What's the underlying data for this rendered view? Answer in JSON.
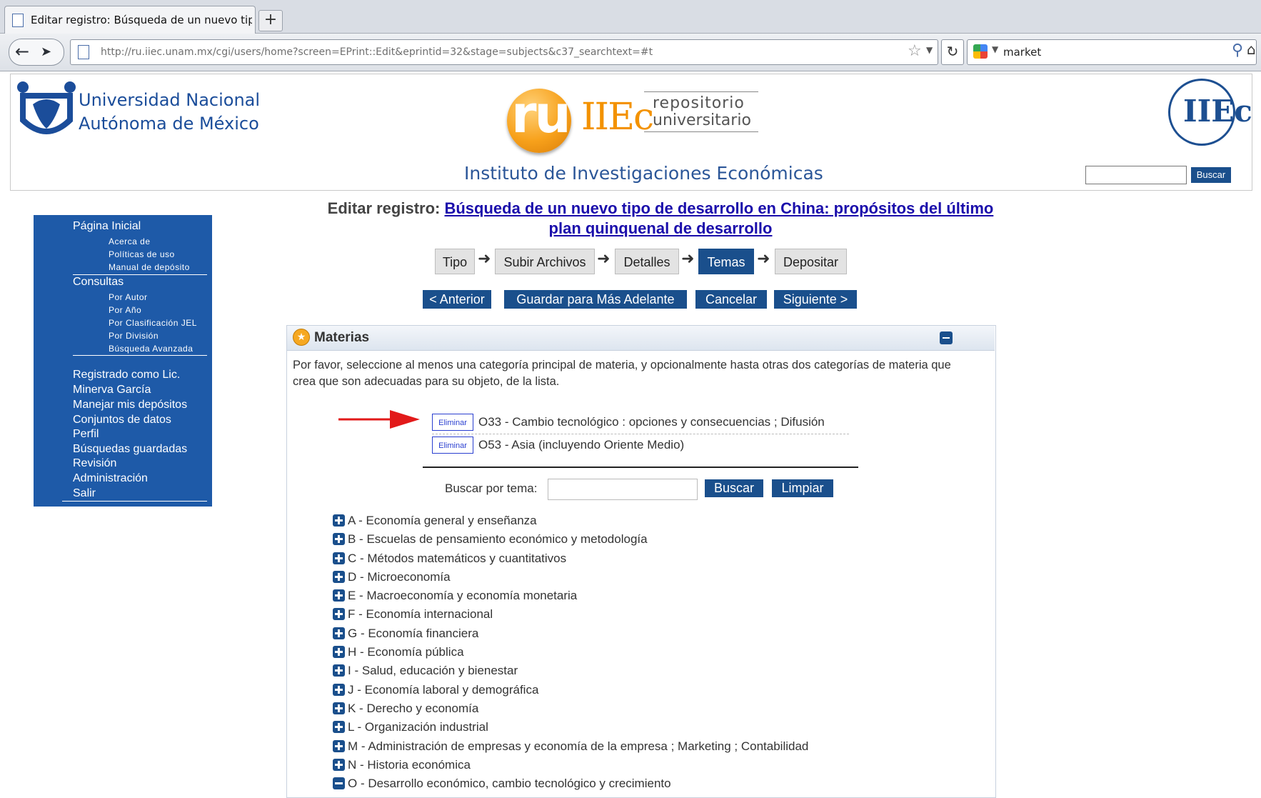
{
  "browser": {
    "tab_title": "Editar registro: Búsqueda de un nuevo tipo ...",
    "new_tab": "+",
    "url": "http://ru.iiec.unam.mx/cgi/users/home?screen=EPrint::Edit&eprintid=32&stage=subjects&c37_searchtext=#t",
    "search_query": "market"
  },
  "header": {
    "unam_line1": "Universidad Nacional",
    "unam_line2": "Autónoma de México",
    "ru": "ru",
    "iiec": "IIEc",
    "repo_line1": "repositorio",
    "repo_line2": "universitario",
    "instituto": "Instituto de Investigaciones Económicas",
    "search_button": "Buscar"
  },
  "sidebar": {
    "pagina_inicial": "Página Inicial",
    "acerca": "Acerca de",
    "politicas": "Políticas de uso",
    "manual": "Manual de depósito",
    "consultas": "Consultas",
    "por_autor": "Por Autor",
    "por_anio": "Por Año",
    "por_jel": "Por Clasificación JEL",
    "por_division": "Por División",
    "busqueda_avanzada": "Búsqueda Avanzada",
    "registrado": "Registrado como Lic.",
    "usuario": "Minerva García",
    "manejar": "Manejar mis depósitos",
    "conjuntos": "Conjuntos de datos",
    "perfil": "Perfil",
    "busquedas": "Búsquedas guardadas",
    "revision": "Revisión",
    "administracion": "Administración",
    "salir": "Salir"
  },
  "main": {
    "edit_prefix": "Editar registro:",
    "record_title_line1": "Búsqueda de un nuevo tipo de desarrollo en China: propósitos del último",
    "record_title_line2": "plan quinquenal de desarrollo",
    "steps": [
      "Tipo",
      "Subir Archivos",
      "Detalles",
      "Temas",
      "Depositar"
    ],
    "active_step": "Temas",
    "buttons": {
      "anterior": "< Anterior",
      "guardar": "Guardar para Más Adelante",
      "cancelar": "Cancelar",
      "siguiente": "Siguiente >"
    }
  },
  "panel": {
    "title": "Materias",
    "instructions": "Por favor, seleccione al menos una categoría principal de materia, y opcionalmente hasta otras dos categorías de materia que crea que son adecuadas para su objeto, de la lista.",
    "eliminar_label": "Eliminar",
    "selected": [
      "O33 - Cambio tecnológico : opciones y consecuencias ; Difusión",
      "O53 - Asia (incluyendo Oriente Medio)"
    ],
    "search_label": "Buscar por tema:",
    "search_value": "",
    "buscar": "Buscar",
    "limpiar": "Limpiar",
    "tree": [
      "A - Economía general y enseñanza",
      "B - Escuelas de pensamiento económico y metodología",
      "C - Métodos matemáticos y cuantitativos",
      "D - Microeconomía",
      "E - Macroeconomía y economía monetaria",
      "F - Economía internacional",
      "G - Economía financiera",
      "H - Economía pública",
      "I - Salud, educación y bienestar",
      "J - Economía laboral y demográfica",
      "K - Derecho y economía",
      "L - Organización industrial",
      "M - Administración de empresas y economía de la empresa ; Marketing ; Contabilidad",
      "N - Historia económica",
      "O - Desarrollo económico, cambio tecnológico y crecimiento"
    ]
  }
}
